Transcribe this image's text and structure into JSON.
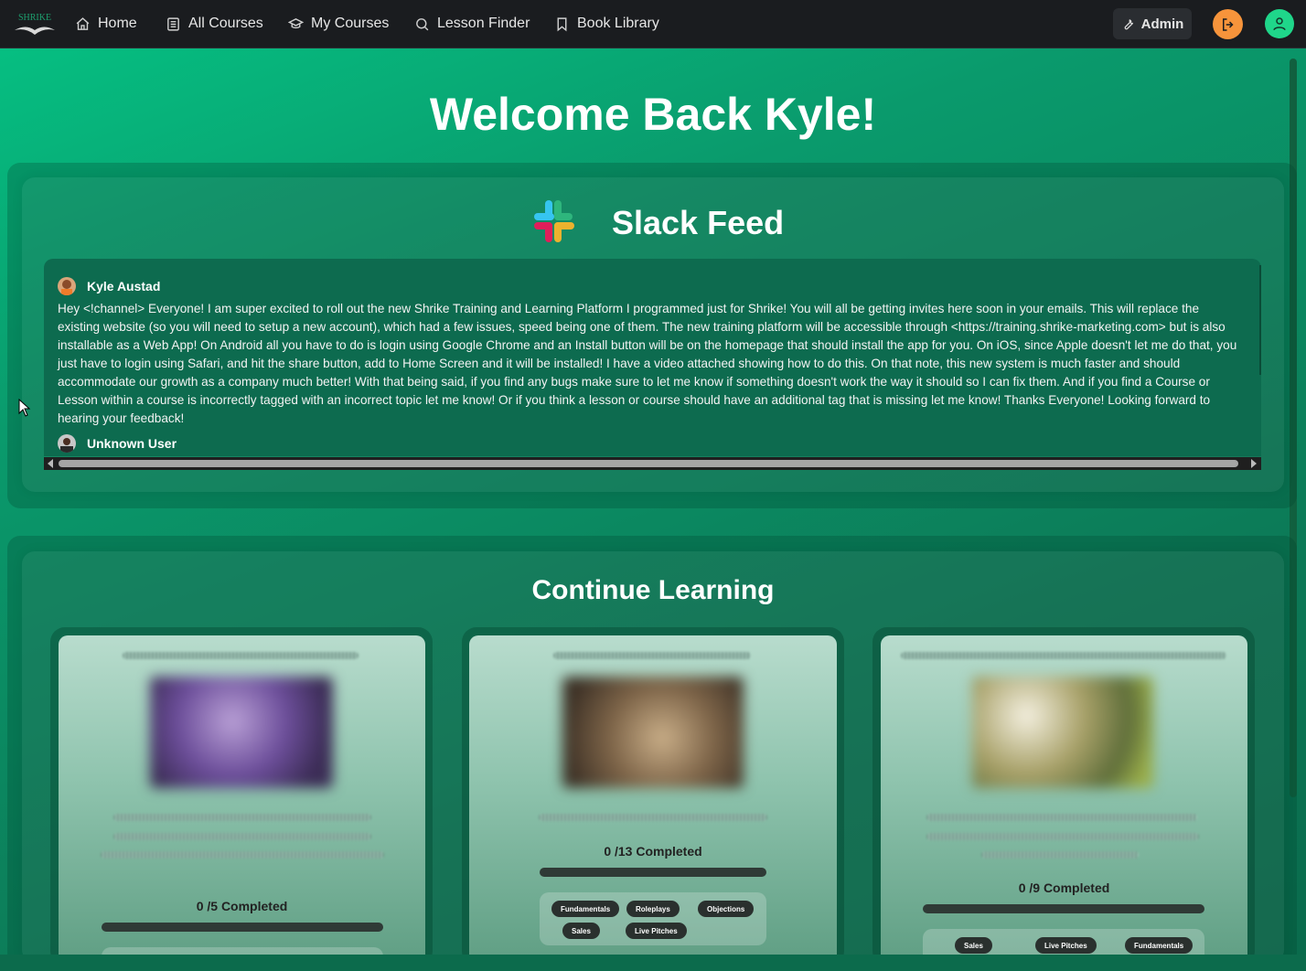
{
  "nav": {
    "brand_text": "SHRIKE",
    "items": [
      {
        "label": "Home",
        "icon": "home-icon"
      },
      {
        "label": "All Courses",
        "icon": "list-icon"
      },
      {
        "label": "My Courses",
        "icon": "graduation-cap-icon"
      },
      {
        "label": "Lesson Finder",
        "icon": "search-icon"
      },
      {
        "label": "Book Library",
        "icon": "bookmark-icon"
      }
    ],
    "admin_label": "Admin",
    "colors": {
      "bar": "#1a1c1f",
      "logout": "#f7943b",
      "profile": "#1fd68a"
    }
  },
  "welcome": "Welcome Back Kyle!",
  "slack": {
    "title": "Slack Feed",
    "messages": [
      {
        "author": "Kyle Austad",
        "text": "Hey <!channel> Everyone! I am super excited to roll out the new Shrike Training and Learning Platform I programmed just for Shrike! You will all be getting invites here soon in your emails. This will replace the existing website (so you will need to setup a new account), which had a few issues, speed being one of them. The new training platform will be accessible through <https://training.shrike-marketing.com> but is also installable as a Web App! On Android all you have to do is login using Google Chrome and an Install button will be on the homepage that should install the app for you. On iOS, since Apple doesn't let me do that, you just have to login using Safari, and hit the share button, add to Home Screen and it will be installed! I have a video attached showing how to do this. On that note, this new system is much faster and should accommodate our growth as a company much better! With that being said, if you find any bugs make sure to let me know if something doesn't work the way it should so I can fix them. And if you find a Course or Lesson within a course is incorrectly tagged with an incorrect topic let me know! Or if you think a lesson or course should have an additional tag that is missing let me know! Thanks Everyone! Looking forward to hearing your feedback!"
      },
      {
        "author": "Unknown User",
        "text": ""
      }
    ]
  },
  "continue_learning": {
    "title": "Continue Learning",
    "courses": [
      {
        "completed_text": "0 /5 Completed",
        "progress": 0,
        "tags": []
      },
      {
        "completed_text": "0 /13 Completed",
        "progress": 0,
        "tags": [
          "Fundamentals",
          "Roleplays",
          "Objections",
          "Sales",
          "Live Pitches"
        ]
      },
      {
        "completed_text": "0 /9 Completed",
        "progress": 0,
        "tags": [
          "Sales",
          "Live Pitches",
          "Fundamentals"
        ]
      }
    ]
  }
}
